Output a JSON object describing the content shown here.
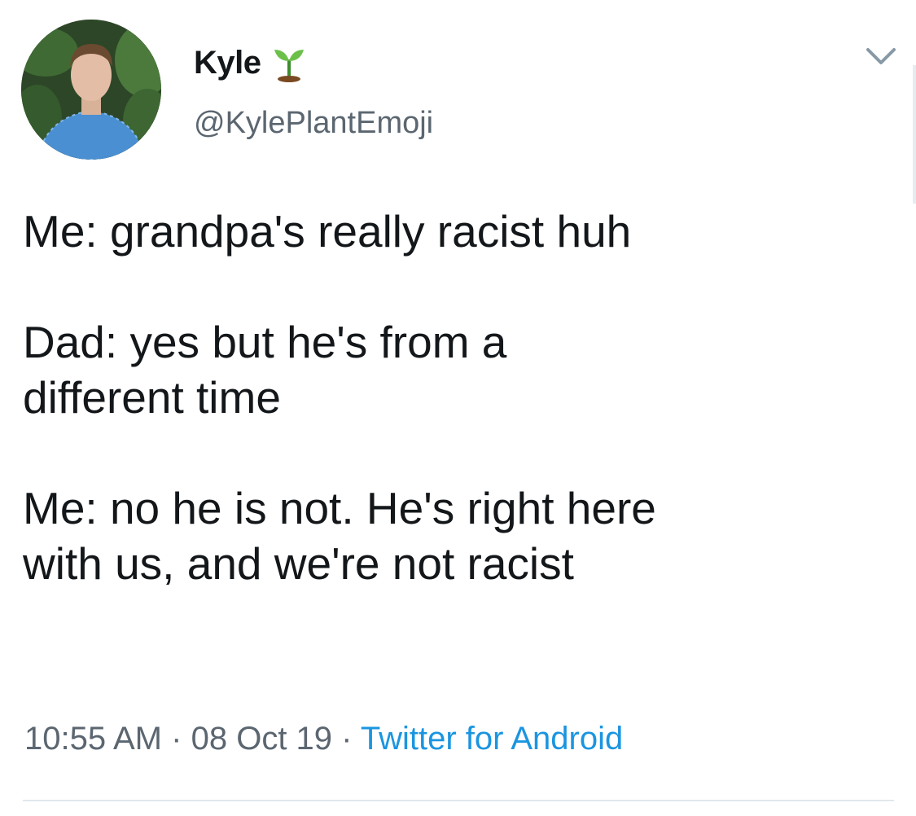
{
  "user": {
    "display_name": "Kyle",
    "name_emoji": "sprout-icon",
    "handle": "@KylePlantEmoji",
    "avatar": "profile-photo"
  },
  "tweet": {
    "lines": [
      "Me: grandpa's really racist huh",
      "Dad: yes but he's from a",
      "different time",
      "Me: no he is not. He's right here",
      "with us, and we're not racist"
    ]
  },
  "meta": {
    "time": "10:55 AM",
    "separator": "·",
    "date": "08 Oct 19",
    "source": "Twitter for Android"
  },
  "colors": {
    "text": "#14171a",
    "muted": "#5b6670",
    "link": "#1b95e0",
    "divider": "#e1e8ed"
  },
  "icons": {
    "menu": "chevron-down-icon"
  }
}
